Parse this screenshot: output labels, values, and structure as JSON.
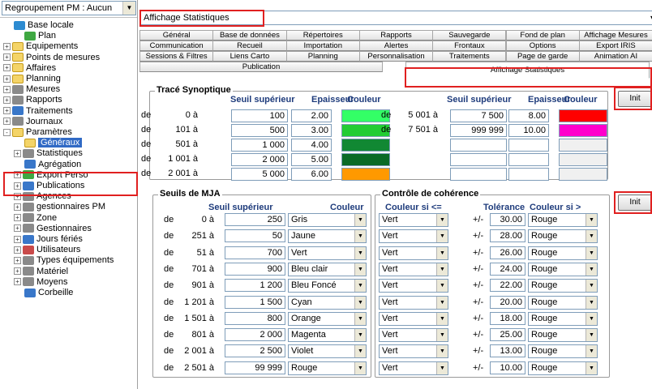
{
  "left": {
    "grouping": {
      "label": "Regroupement PM : Aucun"
    },
    "tree": [
      {
        "label": "Base locale",
        "icon": "database-icon"
      },
      {
        "label": "Plan",
        "icon": "plan-icon"
      },
      {
        "label": "Equipements",
        "icon": "folder-icon"
      },
      {
        "label": "Points de mesures",
        "icon": "folder-icon"
      },
      {
        "label": "Affaires",
        "icon": "folder-icon"
      },
      {
        "label": "Planning",
        "icon": "folder-icon"
      },
      {
        "label": "Mesures",
        "icon": "mesures-icon"
      },
      {
        "label": "Rapports",
        "icon": "rapports-icon"
      },
      {
        "label": "Traitements",
        "icon": "traitements-icon"
      },
      {
        "label": "Journaux",
        "icon": "journaux-icon"
      },
      {
        "label": "Paramètres",
        "icon": "folder-open-icon"
      },
      {
        "label": "Généraux",
        "icon": "generaux-icon"
      },
      {
        "label": "Statistiques",
        "icon": "statistiques-icon"
      },
      {
        "label": "Agrégation",
        "icon": "agregation-icon"
      },
      {
        "label": "Export Perso",
        "icon": "export-icon"
      },
      {
        "label": "Publications",
        "icon": "publications-icon"
      },
      {
        "label": "Agences",
        "icon": "agences-icon"
      },
      {
        "label": "gestionnaires PM",
        "icon": "gestionnaires-icon"
      },
      {
        "label": "Zone",
        "icon": "zone-icon"
      },
      {
        "label": "Gestionnaires",
        "icon": "gestionnaires-icon"
      },
      {
        "label": "Jours fériés",
        "icon": "calendar-icon"
      },
      {
        "label": "Utilisateurs",
        "icon": "users-icon"
      },
      {
        "label": "Types équipements",
        "icon": "types-icon"
      },
      {
        "label": "Matériel",
        "icon": "materiel-icon"
      },
      {
        "label": "Moyens",
        "icon": "moyens-icon"
      },
      {
        "label": "Corbeille",
        "icon": "trash-icon"
      }
    ]
  },
  "right": {
    "view": {
      "label": "Affichage Statistiques"
    },
    "tabs_row1": [
      "Général",
      "Base de données",
      "Répertoires",
      "Rapports",
      "Sauvegarde",
      "Fond de plan",
      "Affichage Mesures"
    ],
    "tabs_row2": [
      "Communication",
      "Recueil",
      "Importation",
      "Alertes",
      "Frontaux",
      "Options",
      "Export IRIS"
    ],
    "tabs_row3": [
      "Sessions & Filtres",
      "Liens Carto",
      "Planning",
      "Personnalisation",
      "Traitements",
      "Page de garde",
      "Animation AI"
    ],
    "tabs_row4": [
      "Publication",
      "Affichage Statistiques"
    ],
    "synoptique": {
      "title": "Tracé Synoptique",
      "col_seuil": "Seuil supérieur",
      "col_epaisseur": "Epaisseur",
      "col_couleur": "Couleur",
      "rows_left": [
        {
          "de": "de",
          "from": "0 à",
          "seuil": "100",
          "epaisseur": "2.00",
          "color": "#33ff66"
        },
        {
          "de": "de",
          "from": "101 à",
          "seuil": "500",
          "epaisseur": "3.00",
          "color": "#22cc33"
        },
        {
          "de": "de",
          "from": "501 à",
          "seuil": "1 000",
          "epaisseur": "4.00",
          "color": "#118833"
        },
        {
          "de": "de",
          "from": "1 001 à",
          "seuil": "2 000",
          "epaisseur": "5.00",
          "color": "#0a6a26"
        },
        {
          "de": "de",
          "from": "2 001 à",
          "seuil": "5 000",
          "epaisseur": "6.00",
          "color": "#ff9900"
        }
      ],
      "rows_right": [
        {
          "de": "de",
          "from": "5 001 à",
          "seuil": "7 500",
          "epaisseur": "8.00",
          "color": "#ff0000"
        },
        {
          "de": "de",
          "from": "7 501 à",
          "seuil": "999 999",
          "epaisseur": "10.00",
          "color": "#ff00cc"
        }
      ],
      "init_label": "Init"
    },
    "mja": {
      "title": "Seuils de MJA",
      "col_seuil": "Seuil supérieur",
      "col_couleur": "Couleur",
      "rows": [
        {
          "de": "de",
          "from": "0 à",
          "seuil": "250",
          "couleur": "Gris"
        },
        {
          "de": "de",
          "from": "251 à",
          "seuil": "50",
          "couleur": "Jaune"
        },
        {
          "de": "de",
          "from": "51 à",
          "seuil": "700",
          "couleur": "Vert"
        },
        {
          "de": "de",
          "from": "701 à",
          "seuil": "900",
          "couleur": "Bleu clair"
        },
        {
          "de": "de",
          "from": "901 à",
          "seuil": "1 200",
          "couleur": "Bleu Foncé"
        },
        {
          "de": "de",
          "from": "1 201 à",
          "seuil": "1 500",
          "couleur": "Cyan"
        },
        {
          "de": "de",
          "from": "1 501 à",
          "seuil": "800",
          "couleur": "Orange"
        },
        {
          "de": "de",
          "from": "801 à",
          "seuil": "2 000",
          "couleur": "Magenta"
        },
        {
          "de": "de",
          "from": "2 001 à",
          "seuil": "2 500",
          "couleur": "Violet"
        },
        {
          "de": "de",
          "from": "2 501 à",
          "seuil": "99 999",
          "couleur": "Rouge"
        }
      ]
    },
    "coherence": {
      "title": "Contrôle de cohérence",
      "col_couleur_si_le": "Couleur si <=",
      "col_tolerance": "Tolérance",
      "col_couleur_si_gt": "Couleur si >",
      "rows": [
        {
          "le": "Vert",
          "pm": "+/-",
          "tol": "30.00",
          "gt": "Rouge"
        },
        {
          "le": "Vert",
          "pm": "+/-",
          "tol": "28.00",
          "gt": "Rouge"
        },
        {
          "le": "Vert",
          "pm": "+/-",
          "tol": "26.00",
          "gt": "Rouge"
        },
        {
          "le": "Vert",
          "pm": "+/-",
          "tol": "24.00",
          "gt": "Rouge"
        },
        {
          "le": "Vert",
          "pm": "+/-",
          "tol": "22.00",
          "gt": "Rouge"
        },
        {
          "le": "Vert",
          "pm": "+/-",
          "tol": "20.00",
          "gt": "Rouge"
        },
        {
          "le": "Vert",
          "pm": "+/-",
          "tol": "18.00",
          "gt": "Rouge"
        },
        {
          "le": "Vert",
          "pm": "+/-",
          "tol": "25.00",
          "gt": "Rouge"
        },
        {
          "le": "Vert",
          "pm": "+/-",
          "tol": "13.00",
          "gt": "Rouge"
        },
        {
          "le": "Vert",
          "pm": "+/-",
          "tol": "10.00",
          "gt": "Rouge"
        }
      ],
      "init_label": "Init"
    }
  }
}
